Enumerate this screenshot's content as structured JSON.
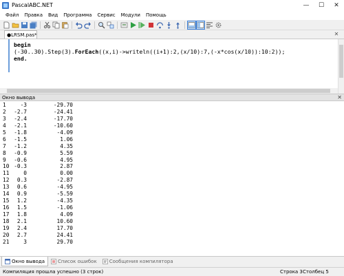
{
  "window": {
    "title": "PascalABC.NET",
    "controls": [
      "—",
      "☐",
      "✕"
    ]
  },
  "menu": [
    "Файл",
    "Правка",
    "Вид",
    "Программа",
    "Сервис",
    "Модули",
    "Помощь"
  ],
  "toolbar_icons": [
    "new-file-icon",
    "open-icon",
    "save-icon",
    "save-all-icon",
    "cut-icon",
    "copy-icon",
    "paste-icon",
    "undo-icon",
    "redo-icon",
    "find-icon",
    "replace-icon",
    "compile-icon",
    "run-icon",
    "debug-run-icon",
    "stop-icon",
    "step-over-icon",
    "step-into-icon",
    "step-out-icon",
    "toggle-output-icon",
    "split-view-icon",
    "format-icon",
    "options-icon"
  ],
  "document_tab": {
    "label": "●LRSM.pas*",
    "close": "✕"
  },
  "editor": {
    "line1": "begin",
    "line2_num_range": "(-30..30)",
    "line2_step": ".Step(3).",
    "line2_foreach": "ForEach",
    "line2_rest": "((x,i)->writeln((i+1):2,(x/10):7,(-x*cos(x/10)):10:2));",
    "line3": "end."
  },
  "output": {
    "title": "Окно вывода",
    "close": "✕",
    "rows": [
      [
        "1",
        "-3",
        "-29.70"
      ],
      [
        "2",
        "-2.7",
        "-24.41"
      ],
      [
        "3",
        "-2.4",
        "-17.70"
      ],
      [
        "4",
        "-2.1",
        "-10.60"
      ],
      [
        "5",
        "-1.8",
        "-4.09"
      ],
      [
        "6",
        "-1.5",
        "1.06"
      ],
      [
        "7",
        "-1.2",
        "4.35"
      ],
      [
        "8",
        "-0.9",
        "5.59"
      ],
      [
        "9",
        "-0.6",
        "4.95"
      ],
      [
        "10",
        "-0.3",
        "2.87"
      ],
      [
        "11",
        "0",
        "0.00"
      ],
      [
        "12",
        "0.3",
        "-2.87"
      ],
      [
        "13",
        "0.6",
        "-4.95"
      ],
      [
        "14",
        "0.9",
        "-5.59"
      ],
      [
        "15",
        "1.2",
        "-4.35"
      ],
      [
        "16",
        "1.5",
        "-1.06"
      ],
      [
        "17",
        "1.8",
        "4.09"
      ],
      [
        "18",
        "2.1",
        "10.60"
      ],
      [
        "19",
        "2.4",
        "17.70"
      ],
      [
        "20",
        "2.7",
        "24.41"
      ],
      [
        "21",
        "3",
        "29.70"
      ]
    ]
  },
  "bottom_tabs": [
    {
      "label": "Окно вывода",
      "active": true
    },
    {
      "label": "Список ошибок",
      "active": false
    },
    {
      "label": "Сообщения компилятора",
      "active": false
    }
  ],
  "status": {
    "message": "Компиляция прошла успешно (3 строк)",
    "row": "Строка  3",
    "col": "Столбец  5"
  },
  "colors": {
    "accent": "#3c7fd8",
    "run": "#2ea043",
    "stop": "#d13438"
  }
}
